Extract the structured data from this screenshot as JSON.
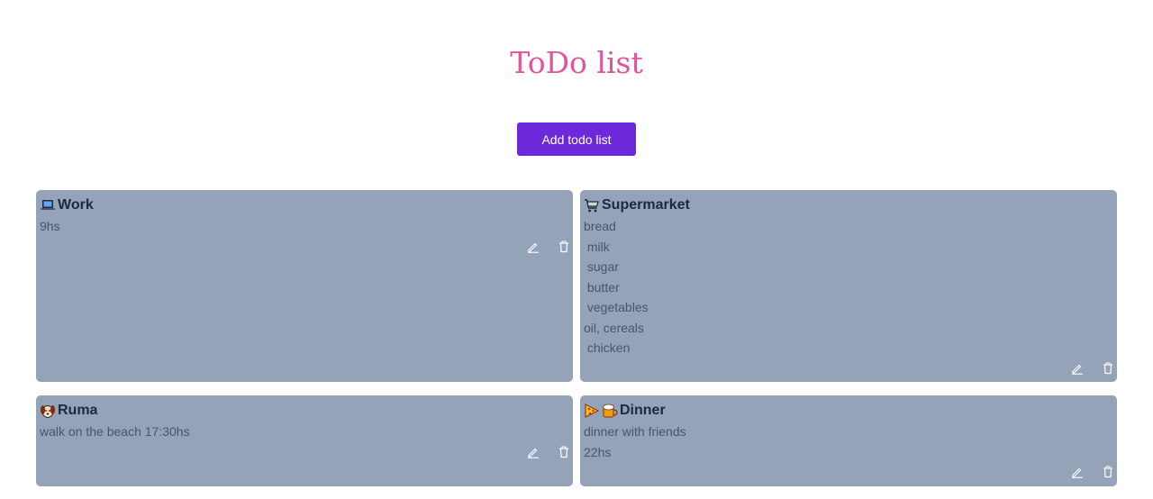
{
  "page": {
    "title": "ToDo list"
  },
  "toolbar": {
    "add_label": "Add todo list"
  },
  "colors": {
    "title": "#e0559a",
    "button": "#6d28d9",
    "card": "#94a3b8"
  },
  "cards": [
    {
      "icon": "laptop-icon",
      "title": "Work",
      "lines": [
        "9hs"
      ]
    },
    {
      "icon": "shopping-cart-icon",
      "title": "Supermarket",
      "lines": [
        "bread",
        " milk",
        " sugar",
        " butter",
        " vegetables",
        "oil, cereals",
        " chicken"
      ]
    },
    {
      "icon": "dog-icon",
      "title": "Ruma",
      "lines": [
        "walk on the beach 17:30hs"
      ]
    },
    {
      "icon": "pizza-beer-icons",
      "title": "Dinner",
      "lines": [
        "dinner with friends",
        "22hs"
      ]
    }
  ]
}
